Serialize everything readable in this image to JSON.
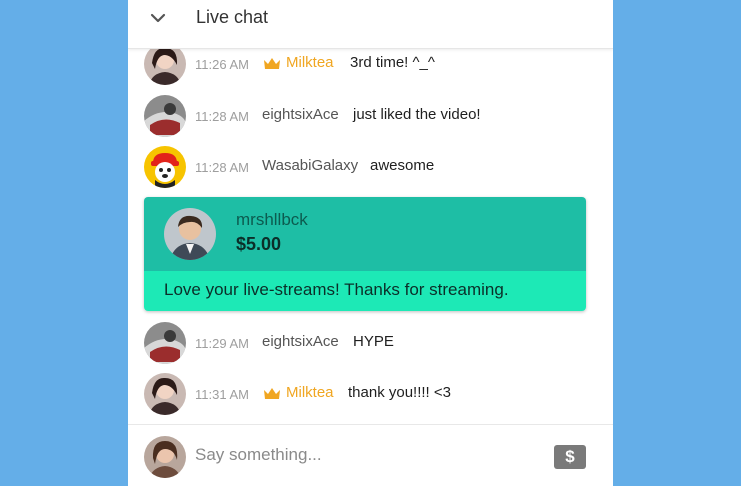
{
  "header": {
    "title": "Live chat",
    "collapse_icon": "chevron-down-icon"
  },
  "messages": [
    {
      "time": "11:26 AM",
      "author": "Milktea",
      "text": "3rd time! ^_^",
      "badge": "crown-icon"
    },
    {
      "time": "11:28 AM",
      "author": "eightsixAce",
      "text": "just liked the video!"
    },
    {
      "time": "11:28 AM",
      "author": "WasabiGalaxy",
      "text": "awesome"
    },
    {
      "time": "11:29 AM",
      "author": "eightsixAce",
      "text": "HYPE"
    },
    {
      "time": "11:31 AM",
      "author": "Milktea",
      "text": "thank you!!!! <3",
      "badge": "crown-icon"
    }
  ],
  "superchat": {
    "author": "mrshllbck",
    "amount": "$5.00",
    "text": "Love your live-streams! Thanks for streaming.",
    "header_color": "#1ebea5",
    "body_color": "#1de9b6"
  },
  "input": {
    "placeholder": "Say something...",
    "superchat_button_icon": "dollar-icon",
    "superchat_button_label": "$"
  },
  "colors": {
    "background": "#64aee8",
    "owner_name": "#f0a621",
    "timestamp": "#9e9e9e"
  }
}
